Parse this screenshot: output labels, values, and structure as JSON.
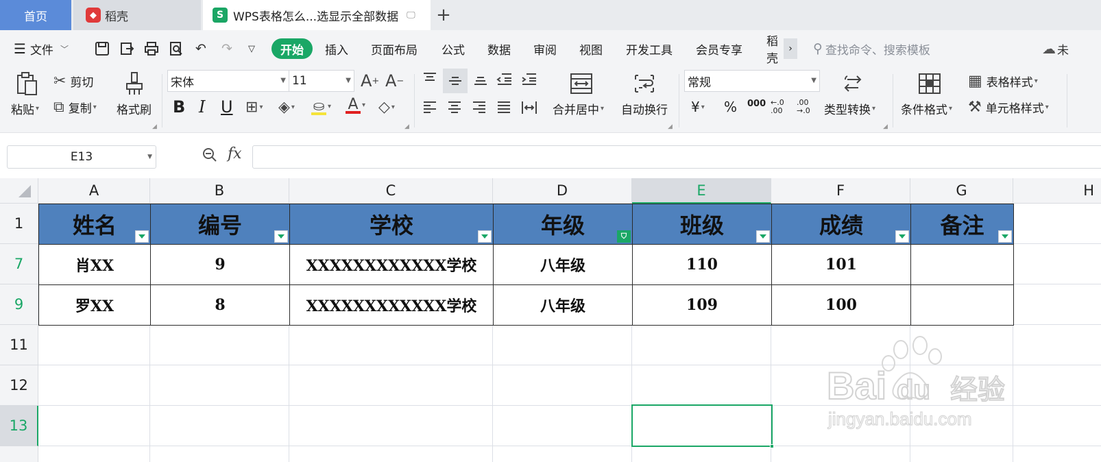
{
  "tabs": {
    "home": "首页",
    "daoke": "稻壳",
    "doc": "WPS表格怎么...选显示全部数据",
    "add": "+"
  },
  "menubar": {
    "file": "文件",
    "items": [
      "开始",
      "插入",
      "页面布局",
      "公式",
      "数据",
      "审阅",
      "视图",
      "开发工具",
      "会员专享",
      "稻壳"
    ],
    "more": "›",
    "search_placeholder": "查找命令、搜索模板",
    "cloud_label": "未"
  },
  "ribbon": {
    "paste": "粘贴",
    "cut": "剪切",
    "copy": "复制",
    "format_painter": "格式刷",
    "font_name": "宋体",
    "font_size": "11",
    "bold": "B",
    "italic": "I",
    "underline": "U",
    "font_color_glyph": "A",
    "merge_center": "合并居中",
    "wrap_text": "自动换行",
    "number_format": "常规",
    "currency": "¥",
    "percent": "%",
    "thousands": "000",
    "inc_decimal": "←.0 .00",
    "dec_decimal": ".00 →.0",
    "type_convert": "类型转换",
    "conditional_format": "条件格式",
    "table_style": "表格样式",
    "cell_style": "单元格样式"
  },
  "formula": {
    "name_box": "E13",
    "fx": "fx",
    "value": ""
  },
  "sheet": {
    "columns": [
      "A",
      "B",
      "C",
      "D",
      "E",
      "F",
      "G",
      "H"
    ],
    "active_column": "E",
    "rows": [
      "1",
      "7",
      "9",
      "11",
      "12",
      "13"
    ],
    "active_row": "13",
    "header": [
      "姓名",
      "编号",
      "学校",
      "年级",
      "班级",
      "成绩",
      "备注"
    ],
    "filtered_column": "年级",
    "data": [
      [
        "肖XX",
        "9",
        "XXXXXXXXXXXX学校",
        "八年级",
        "110",
        "101",
        ""
      ],
      [
        "罗XX",
        "8",
        "XXXXXXXXXXXX学校",
        "八年级",
        "109",
        "100",
        ""
      ]
    ],
    "selected_cell": "E13"
  },
  "watermark": {
    "brand": "Bai",
    "brand_suffix": "du",
    "brand_cn": "经验",
    "url": "jingyan.baidu.com"
  },
  "colors": {
    "accent_green": "#1aa766",
    "header_fill": "#4f81bd",
    "home_tab": "#5b8bd9"
  }
}
